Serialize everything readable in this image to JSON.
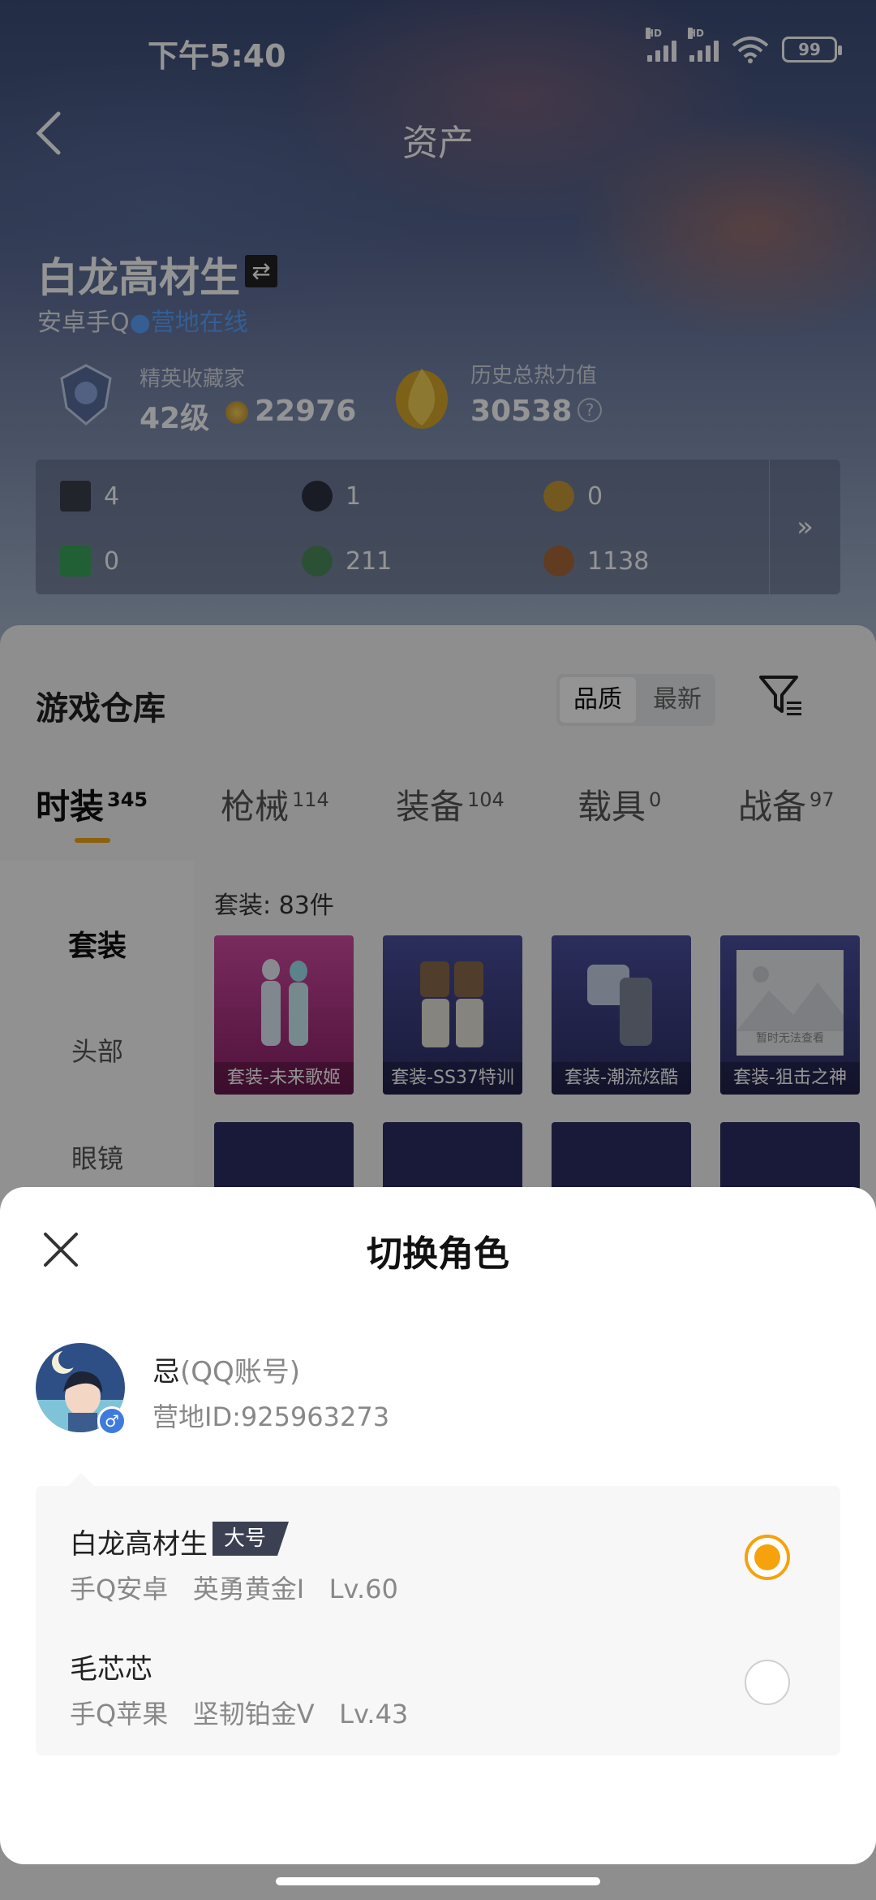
{
  "status_bar": {
    "time": "下午5:40",
    "battery": "99",
    "network_label": "HD"
  },
  "nav": {
    "title": "资产"
  },
  "player": {
    "name": "白龙高材生",
    "platform": "安卓手Q",
    "online_status": "营地在线"
  },
  "stats": {
    "collector_label": "精英收藏家",
    "level": "42级",
    "coins": "22976",
    "heat_label": "历史总热力值",
    "heat_value": "30538"
  },
  "resources": [
    "4",
    "1",
    "0",
    "0",
    "211",
    "1138"
  ],
  "warehouse": {
    "title": "游戏仓库",
    "sort_options": [
      "品质",
      "最新"
    ],
    "tabs": [
      {
        "label": "时装",
        "count": "345"
      },
      {
        "label": "枪械",
        "count": "114"
      },
      {
        "label": "装备",
        "count": "104"
      },
      {
        "label": "载具",
        "count": "0"
      },
      {
        "label": "战备",
        "count": "97"
      }
    ],
    "side_categories": [
      "套装",
      "头部",
      "眼镜"
    ],
    "set_count": "套装: 83件",
    "cards": [
      {
        "caption": "套装-未来歌姬",
        "color": "#b4287e"
      },
      {
        "caption": "套装-SS37特训",
        "color": "#3a3f86"
      },
      {
        "caption": "套装-潮流炫酷",
        "color": "#3a3f86"
      },
      {
        "caption": "套装-狙击之神",
        "color": "#3a3f86"
      }
    ],
    "placeholder_text": "暂时无法查看"
  },
  "sheet": {
    "title": "切换角色",
    "account": {
      "name": "忌",
      "type": "(QQ账号)",
      "camp_id": "营地ID:925963273"
    },
    "roles": [
      {
        "name": "白龙高材生",
        "tag": "大号",
        "meta": "手Q安卓   英勇黄金I   Lv.60",
        "selected": true
      },
      {
        "name": "毛芯芯",
        "tag": "",
        "meta": "手Q苹果   坚韧铂金V   Lv.43",
        "selected": false
      }
    ]
  },
  "colors": {
    "accent": "#f5a20c",
    "online": "#5aa3ff",
    "tag_bg": "#3b4052"
  }
}
